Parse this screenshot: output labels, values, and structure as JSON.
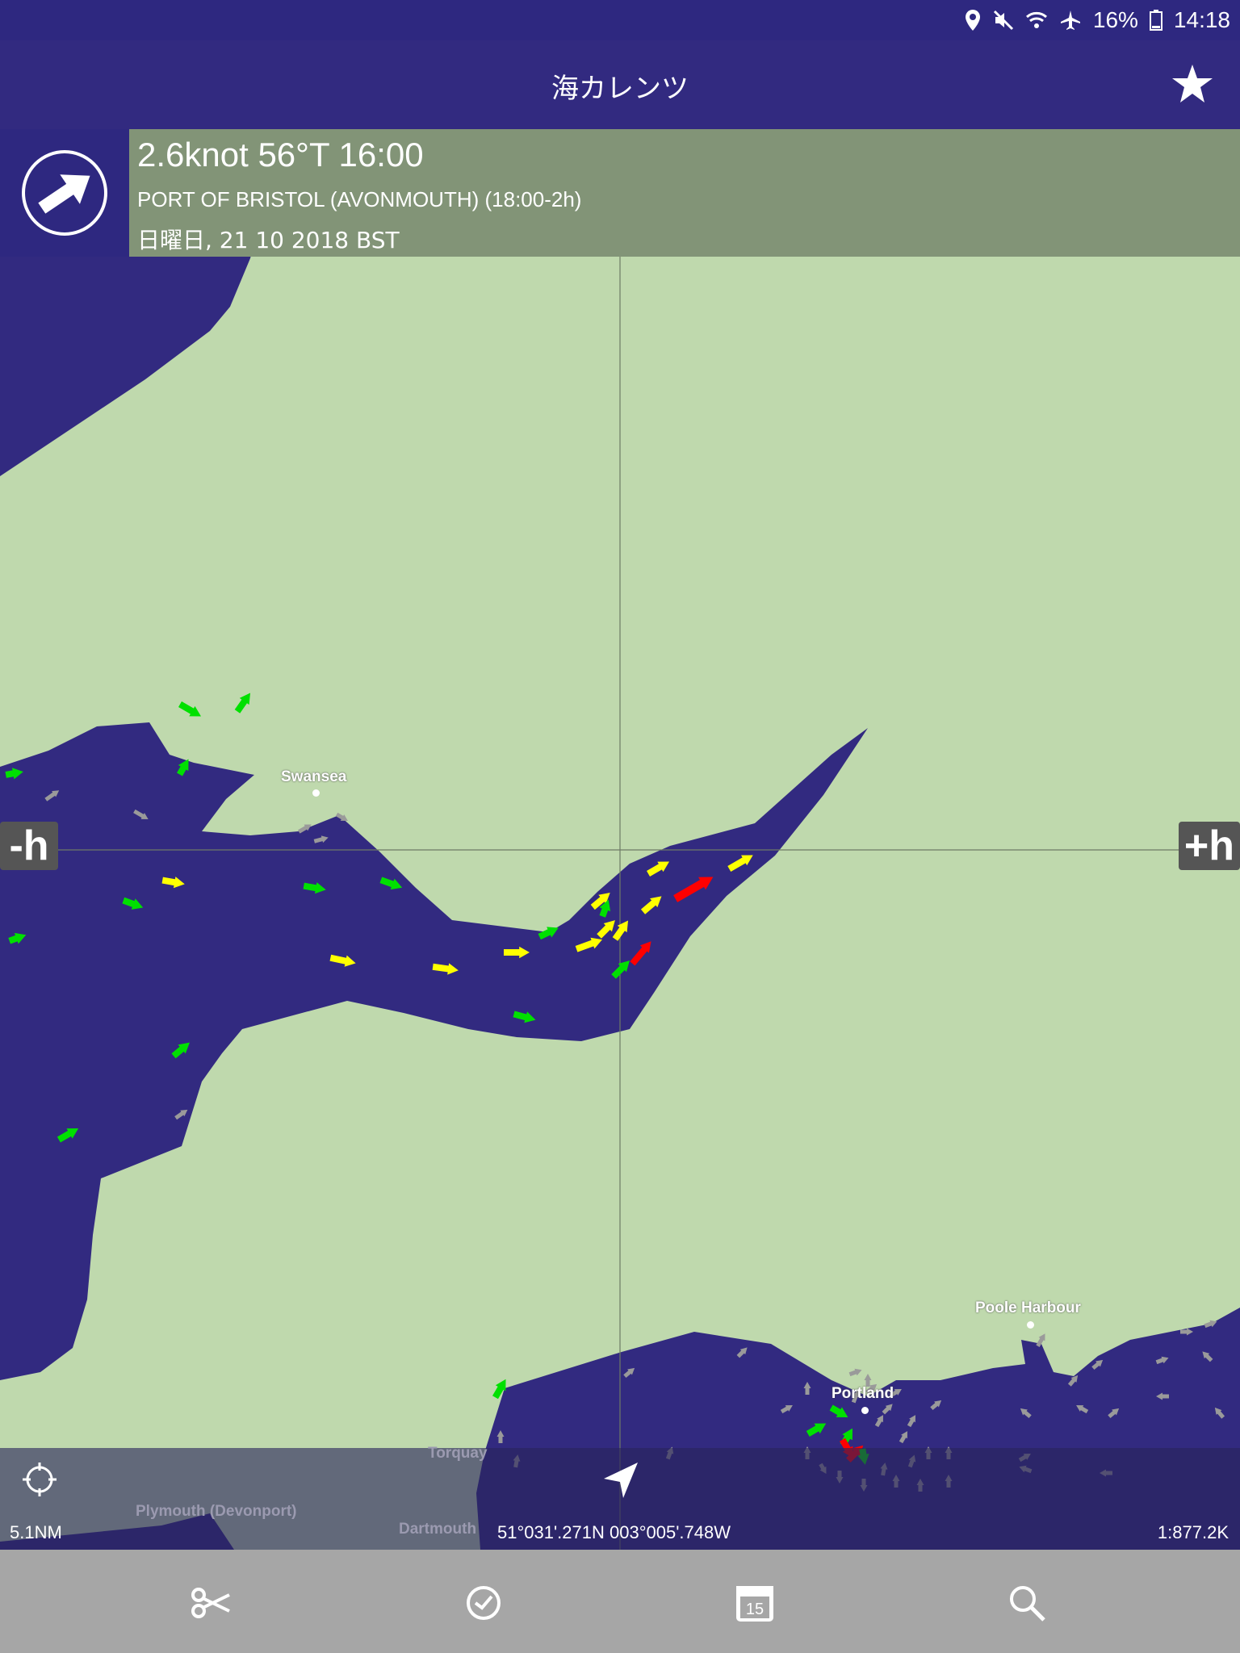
{
  "status": {
    "battery": "16%",
    "time": "14:18",
    "icons": [
      "location-icon",
      "mute-icon",
      "wifi-icon",
      "airplane-icon",
      "battery-icon"
    ]
  },
  "app": {
    "title": "海カレンツ",
    "favorite_icon": "star-icon"
  },
  "info": {
    "speed_line": "2.6knot 56°T 16:00",
    "station": "PORT OF BRISTOL (AVONMOUTH) (18:00-2h)",
    "date": "日曜日, 21 10 2018 BST",
    "direction_icon": "arrow-northeast-icon"
  },
  "map": {
    "minus_hour": "-h",
    "plus_hour": "+h",
    "places": {
      "swansea": "Swansea",
      "poole": "Poole Harbour",
      "portland": "Portland",
      "torquay": "Torquay",
      "plymouth": "Plymouth (Devonport)",
      "dartmouth": "Dartmouth"
    },
    "colors": {
      "sea": "#322A80",
      "land": "#BFD9AD",
      "slow": "#00E000",
      "medium": "#FFFF00",
      "fast": "#FF0000",
      "minor": "#9A9A9A"
    }
  },
  "footer": {
    "scale": "5.1NM",
    "coords": "51°031'.271N 003°005'.748W",
    "ratio": "1:877.2K"
  },
  "toolbar": {
    "items": [
      "scissors-icon",
      "clock-icon",
      "calendar-icon",
      "search-icon"
    ],
    "calendar_day": "15"
  }
}
